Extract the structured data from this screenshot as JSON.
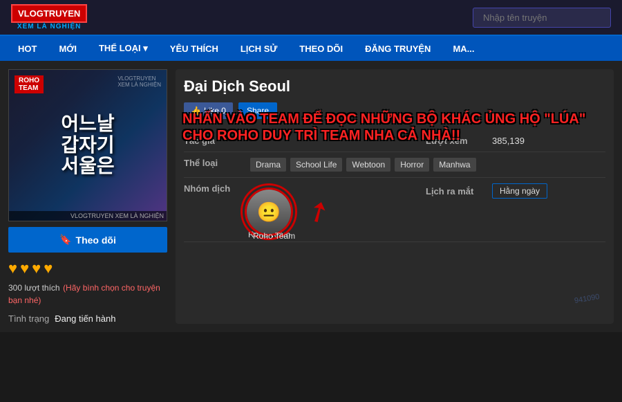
{
  "header": {
    "logo_main": "VLOGTRUYEN",
    "logo_sub": "XEM LÀ NGHIỆN",
    "search_placeholder": "Nhập tên truyện"
  },
  "nav": {
    "items": [
      "HOT",
      "MỚI",
      "THỂ LOẠI ▾",
      "YÊU THÍCH",
      "LỊCH SỬ",
      "THEO DÕI",
      "ĐĂNG TRUYỆN",
      "MA..."
    ]
  },
  "sidebar": {
    "cover_title": "어느날\n갑자기\n서울은",
    "cover_label": "VLOGTRUYEN\nXEM LÀ NGHIỆN",
    "follow_label": "Theo dõi",
    "likes_count": "300 lượt thích",
    "likes_vote": "(Hãy bình chọn cho truyện bạn nhé)",
    "status_label": "Tình trạng",
    "status_value": "Đang tiến hành"
  },
  "manga": {
    "title": "Đại Dịch Seoul",
    "like_label": "Like 0",
    "share_label": "Share",
    "overlay_text": "NHẤN VÀO TEAM ĐỂ ĐỌC NHỮNG BỘ KHÁC ỦNG HỘ \"LÚA\" CHO ROHO DUY TRÌ TEAM NHA CẢ NHÀ!!",
    "info": {
      "author_label": "Tác giả",
      "author_value": "",
      "views_label": "Lượt xem",
      "views_value": "385,139",
      "genre_label": "Thể loại",
      "genres": [
        "Drama",
        "School Life",
        "Webtoon",
        "Horror",
        "Manhwa"
      ],
      "group_label": "Nhóm dịch",
      "team_name": "Roho Team",
      "release_label": "Lịch ra mắt",
      "release_value": "Hằng ngày"
    }
  }
}
